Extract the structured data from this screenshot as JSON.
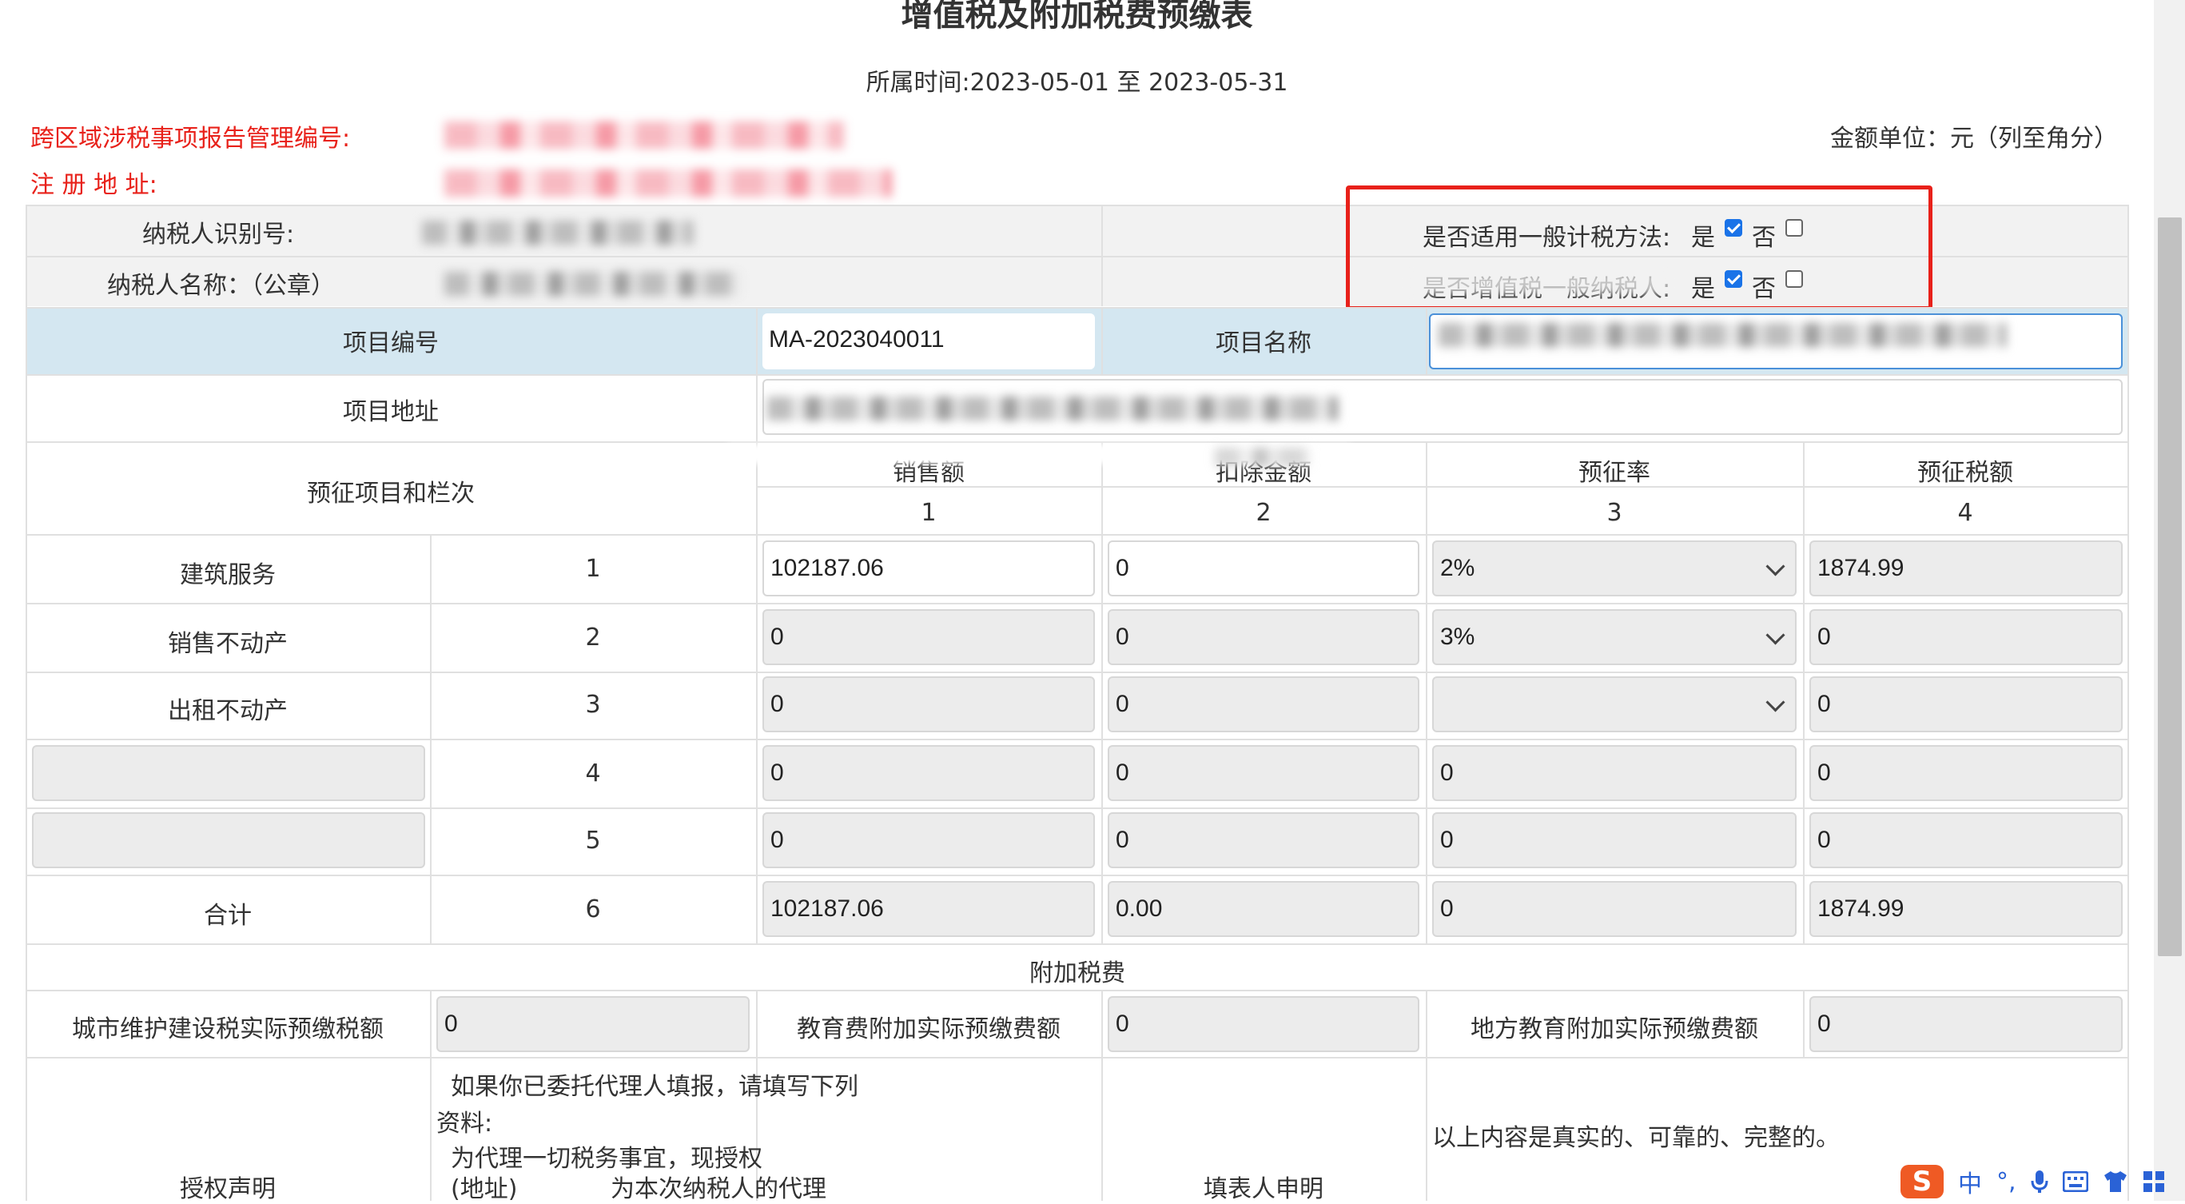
{
  "title": "增值税及附加税费预缴表",
  "period_text": "所属时间:2023-05-01 至 2023-05-31",
  "header": {
    "cross_region_label": "跨区域涉税事项报告管理编号:",
    "address_label": "注 册 地 址:",
    "unit_text": "金额单位：元（列至角分）",
    "taxpayer_id_label": "纳税人识别号:",
    "taxpayer_name_label": "纳税人名称：（公章）",
    "general_method_label": "是否适用一般计税方法:",
    "general_taxpayer_label": "是否增值税一般纳税人:",
    "yes_label": "是",
    "no_label": "否",
    "general_method_yes": true,
    "general_taxpayer_yes": true
  },
  "project": {
    "code_label": "项目编号",
    "code_value": "MA-2023040011",
    "name_label": "项目名称",
    "address_label": "项目地址"
  },
  "table": {
    "item_header": "预征项目和栏次",
    "columns": [
      {
        "label": "销售额",
        "num": "1"
      },
      {
        "label": "扣除金额",
        "num": "2"
      },
      {
        "label": "预征率",
        "num": "3"
      },
      {
        "label": "预征税额",
        "num": "4"
      }
    ],
    "rows": [
      {
        "name": "建筑服务",
        "num": "1",
        "sales": "102187.06",
        "deduct": "0",
        "rate": "2%",
        "tax": "1874.99"
      },
      {
        "name": "销售不动产",
        "num": "2",
        "sales": "0",
        "deduct": "0",
        "rate": "3%",
        "tax": "0"
      },
      {
        "name": "出租不动产",
        "num": "3",
        "sales": "0",
        "deduct": "0",
        "rate": "",
        "tax": "0"
      },
      {
        "name": "",
        "num": "4",
        "sales": "0",
        "deduct": "0",
        "rate": "0",
        "tax": "0"
      },
      {
        "name": "",
        "num": "5",
        "sales": "0",
        "deduct": "0",
        "rate": "0",
        "tax": "0"
      },
      {
        "name": "合计",
        "num": "6",
        "sales": "102187.06",
        "deduct": "0.00",
        "rate": "0",
        "tax": "1874.99"
      }
    ]
  },
  "surcharge": {
    "section_label": "附加税费",
    "city_label": "城市维护建设税实际预缴税额",
    "city_value": "0",
    "edu_label": "教育费附加实际预缴费额",
    "edu_value": "0",
    "local_edu_label": "地方教育附加实际预缴费额",
    "local_edu_value": "0"
  },
  "declaration": {
    "auth_label": "授权声明",
    "auth_text_1": "如果你已委托代理人填报，请填写下列",
    "auth_text_2": "资料:",
    "auth_text_3": "为代理一切税务事宜，现授权",
    "auth_text_4": "(地址)",
    "auth_text_5": "为本次纳税人的代理",
    "filler_label": "填表人申明",
    "filler_text": "以上内容是真实的、可靠的、完整的。"
  },
  "ime": {
    "logo": "S",
    "lang": "中",
    "punct": "°,",
    "icons": [
      "microphone-icon",
      "keyboard-icon",
      "shirt-icon",
      "grid-icon"
    ]
  }
}
